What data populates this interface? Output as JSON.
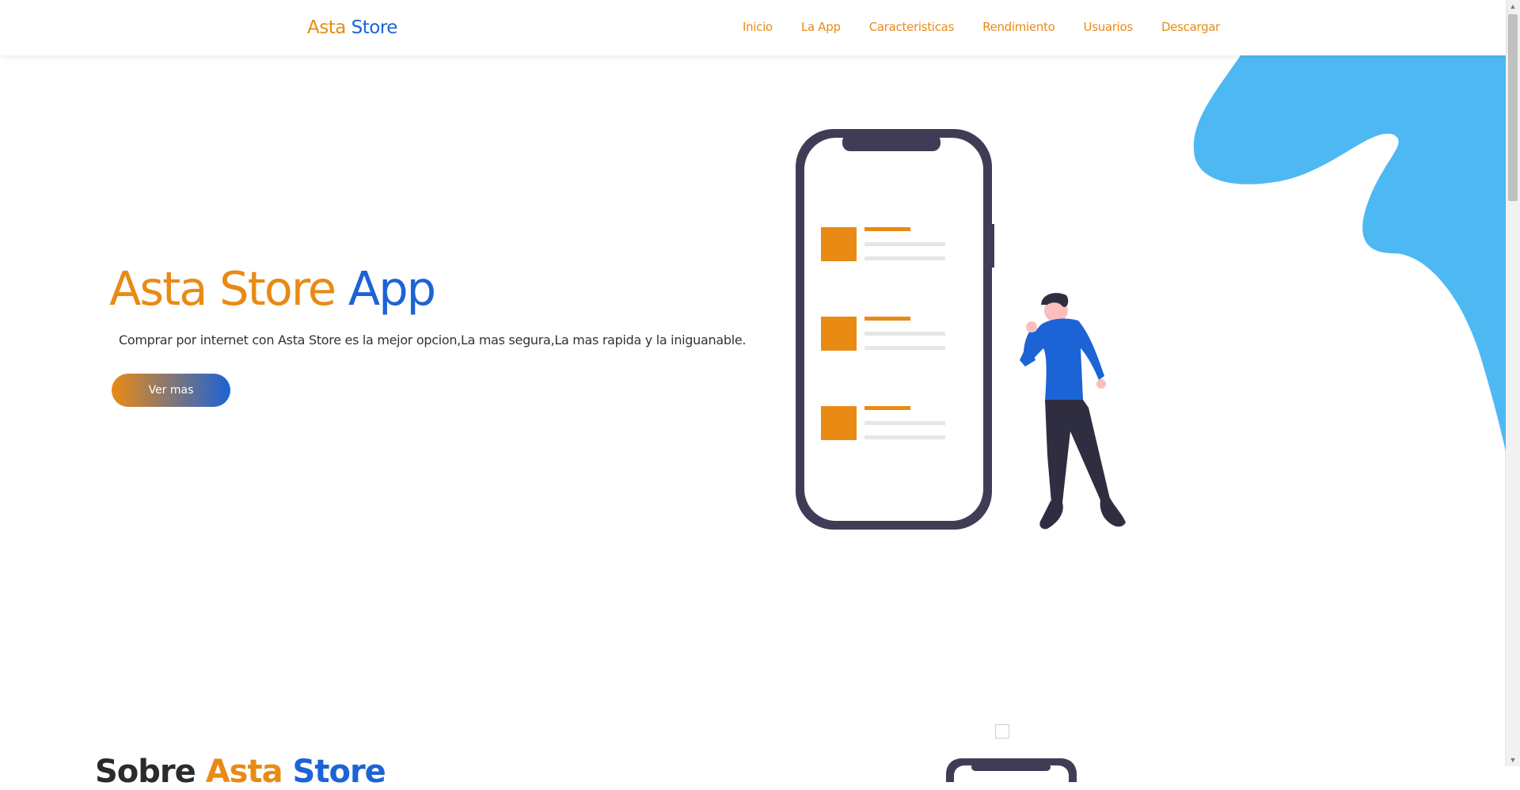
{
  "brand": {
    "part1": "Asta",
    "part2": "Store"
  },
  "nav": {
    "items": [
      {
        "label": "Inicio"
      },
      {
        "label": "La App"
      },
      {
        "label": "Caracteristicas"
      },
      {
        "label": "Rendimiento"
      },
      {
        "label": "Usuarios"
      },
      {
        "label": "Descargar"
      }
    ]
  },
  "hero": {
    "title_part1": "Asta Store",
    "title_part2": "App",
    "subtitle": "Comprar por internet con Asta Store es la mejor opcion,La mas segura,La mas rapida y la iniguanable.",
    "button_label": "Ver mas"
  },
  "next_section": {
    "title_part1": "Sobre",
    "title_part2": "Asta",
    "title_part3": "Store"
  },
  "colors": {
    "accent_orange": "#e98a15",
    "accent_blue": "#1c63d6",
    "blob_blue": "#4eb8f3",
    "phone_dark": "#3f3d56"
  },
  "icons": [
    "phone-illustration",
    "person-illustration",
    "blob-shape"
  ]
}
